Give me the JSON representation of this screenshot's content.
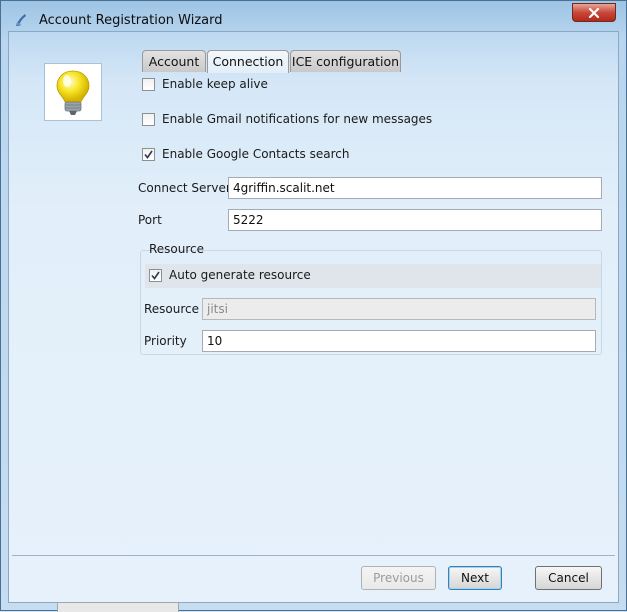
{
  "window": {
    "title": "Account Registration Wizard",
    "title_icon": "jitsi-app-icon",
    "close_icon": "close-icon"
  },
  "logo": {
    "icon": "lightbulb-icon",
    "color": "#f6e21a"
  },
  "tabs": [
    {
      "label": "Account",
      "active": false
    },
    {
      "label": "Connection",
      "active": true
    },
    {
      "label": "ICE configuration",
      "active": false
    }
  ],
  "options": {
    "keep_alive": {
      "label": "Enable keep alive",
      "checked": false
    },
    "gmail_notifications": {
      "label": "Enable Gmail notifications for new messages",
      "checked": false
    },
    "google_contacts": {
      "label": "Enable Google Contacts search",
      "checked": true
    }
  },
  "connect_server": {
    "label": "Connect Server",
    "value": "4griffin.scalit.net"
  },
  "port": {
    "label": "Port",
    "value": "5222"
  },
  "resource_group": {
    "title": "Resource",
    "auto_generate": {
      "label": "Auto generate resource",
      "checked": true
    },
    "resource": {
      "label": "Resource",
      "value": "jitsi"
    },
    "priority": {
      "label": "Priority",
      "value": "10"
    }
  },
  "buttons": {
    "previous": "Previous",
    "next": "Next",
    "cancel": "Cancel"
  }
}
